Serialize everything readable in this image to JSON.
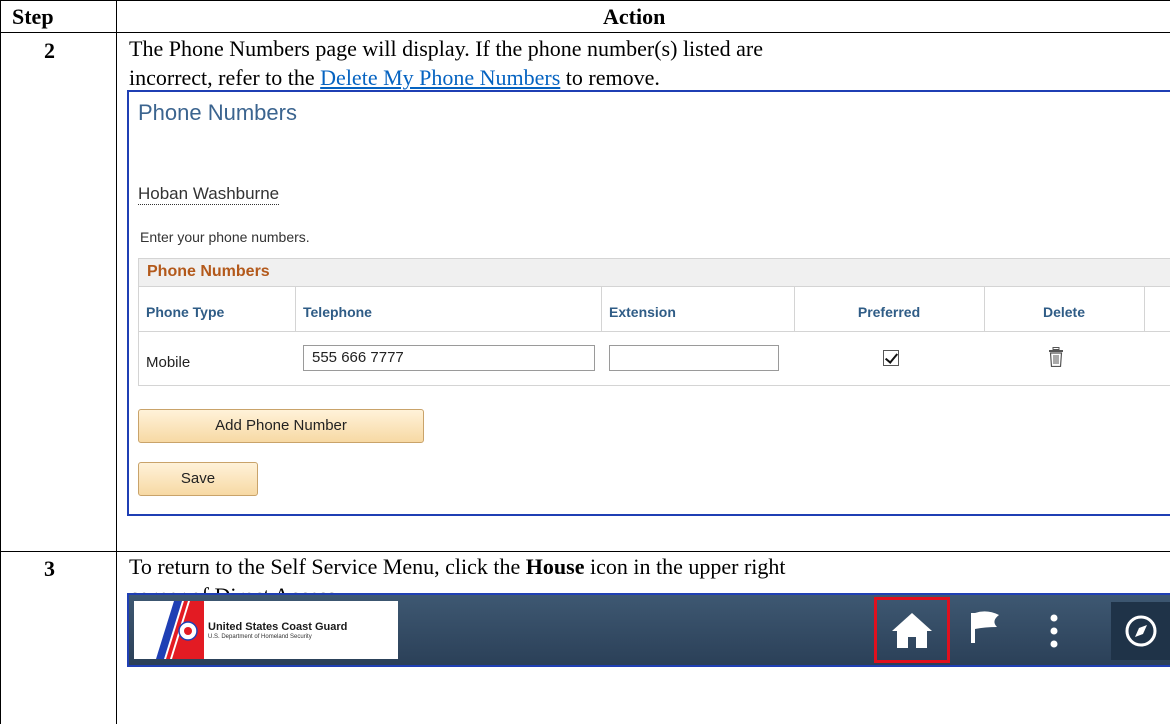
{
  "table": {
    "header_step": "Step",
    "header_action": "Action"
  },
  "rows": [
    {
      "step": "2",
      "line1": "The Phone Numbers page will display.  If the phone number(s) listed are",
      "line2_before": "incorrect, refer to the ",
      "line2_link": "Delete My Phone Numbers",
      "line2_after": " to remove."
    },
    {
      "step": "3",
      "line1_before": "To return to the Self Service Menu, click the ",
      "line1_bold": "House",
      "line1_after": " icon in the upper right",
      "line2": "corner of Direct Access."
    }
  ],
  "phone_page": {
    "title": "Phone Numbers",
    "person_name": "Hoban Washburne",
    "instructions": "Enter your phone numbers.",
    "grid_title": "Phone Numbers",
    "columns": [
      "Phone Type",
      "Telephone",
      "Extension",
      "Preferred",
      "Delete"
    ],
    "row": {
      "phone_type": "Mobile",
      "telephone": "555 666 7777",
      "extension": "",
      "preferred": true
    },
    "add_button": "Add Phone Number",
    "save_button": "Save"
  },
  "banner": {
    "org_name": "United States Coast Guard",
    "org_sub": "U.S. Department of Homeland Security",
    "icons": [
      "home-icon",
      "flag-icon",
      "more-vertical-icon",
      "compass-icon"
    ],
    "bar_color": "#34506b",
    "highlight_color": "#e0101e"
  }
}
